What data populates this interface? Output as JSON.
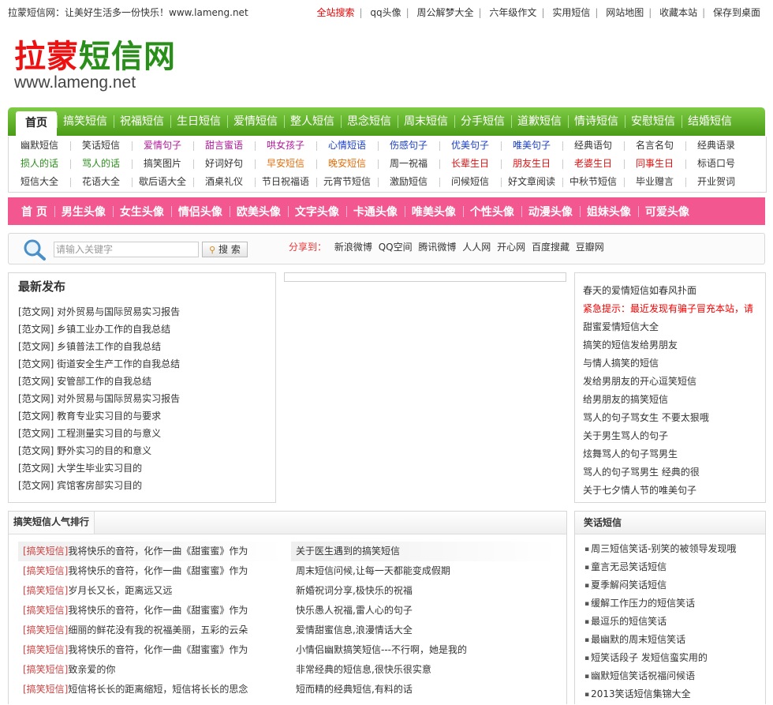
{
  "topbar": {
    "slogan": "拉蒙短信网：让美好生活多一份快乐！www.lameng.net",
    "links": [
      "全站搜索",
      "qq头像",
      "周公解梦大全",
      "六年级作文",
      "实用短信",
      "网站地图",
      "收藏本站",
      "保存到桌面"
    ]
  },
  "logo": {
    "cn_part1": "拉蒙",
    "cn_part2": "短信网",
    "en": "www.lameng.net"
  },
  "green_nav": [
    "首页",
    "搞笑短信",
    "祝福短信",
    "生日短信",
    "爱情短信",
    "整人短信",
    "思念短信",
    "周末短信",
    "分手短信",
    "道歉短信",
    "情诗短信",
    "安慰短信",
    "结婚短信"
  ],
  "link_grid": [
    [
      {
        "t": "幽默短信",
        "c": "#333"
      },
      {
        "t": "笑话短信",
        "c": "#333"
      },
      {
        "t": "爱情句子",
        "c": "#b0189a"
      },
      {
        "t": "甜言蜜语",
        "c": "#b0189a"
      },
      {
        "t": "哄女孩子",
        "c": "#b0189a"
      },
      {
        "t": "心情短语",
        "c": "#1a3fc8"
      },
      {
        "t": "伤感句子",
        "c": "#1a3fc8"
      },
      {
        "t": "优美句子",
        "c": "#1a3fc8"
      },
      {
        "t": "唯美句子",
        "c": "#1a3fc8"
      },
      {
        "t": "经典语句",
        "c": "#333"
      },
      {
        "t": "名言名句",
        "c": "#333"
      },
      {
        "t": "经典语录",
        "c": "#333"
      }
    ],
    [
      {
        "t": "损人的话",
        "c": "#2a8f1a"
      },
      {
        "t": "骂人的话",
        "c": "#2a8f1a"
      },
      {
        "t": "搞笑图片",
        "c": "#333"
      },
      {
        "t": "好词好句",
        "c": "#333"
      },
      {
        "t": "早安短信",
        "c": "#e07010"
      },
      {
        "t": "晚安短信",
        "c": "#e07010"
      },
      {
        "t": "周一祝福",
        "c": "#333"
      },
      {
        "t": "长辈生日",
        "c": "#e01010"
      },
      {
        "t": "朋友生日",
        "c": "#e01010"
      },
      {
        "t": "老婆生日",
        "c": "#e01010"
      },
      {
        "t": "同事生日",
        "c": "#e01010"
      },
      {
        "t": "标语口号",
        "c": "#333"
      }
    ],
    [
      {
        "t": "短信大全",
        "c": "#333"
      },
      {
        "t": "花语大全",
        "c": "#333"
      },
      {
        "t": "歇后语大全",
        "c": "#333"
      },
      {
        "t": "酒桌礼仪",
        "c": "#333"
      },
      {
        "t": "节日祝福语",
        "c": "#333"
      },
      {
        "t": "元宵节短信",
        "c": "#333"
      },
      {
        "t": "激励短信",
        "c": "#333"
      },
      {
        "t": "问候短信",
        "c": "#333"
      },
      {
        "t": "好文章阅读",
        "c": "#333"
      },
      {
        "t": "中秋节短信",
        "c": "#333"
      },
      {
        "t": "毕业赠言",
        "c": "#333"
      },
      {
        "t": "开业贺词",
        "c": "#333"
      }
    ]
  ],
  "pink_nav": [
    "首 页",
    "男生头像",
    "女生头像",
    "情侣头像",
    "欧美头像",
    "文字头像",
    "卡通头像",
    "唯美头像",
    "个性头像",
    "动漫头像",
    "姐妹头像",
    "可爱头像"
  ],
  "search": {
    "placeholder": "请输入关键字",
    "button": "搜 索",
    "share_label": "分享到：",
    "share_targets": [
      "新浪微博",
      "QQ空间",
      "腾讯微博",
      "人人网",
      "开心网",
      "百度搜藏",
      "豆瓣网"
    ]
  },
  "latest": {
    "title": "最新发布",
    "items": [
      "[范文网] 对外贸易与国际贸易实习报告",
      "[范文网] 乡镇工业办工作的自我总结",
      "[范文网] 乡镇普法工作的自我总结",
      "[范文网] 街道安全生产工作的自我总结",
      "[范文网] 安管部工作的自我总结",
      "[范文网] 对外贸易与国际贸易实习报告",
      "[范文网] 教育专业实习目的与要求",
      "[范文网] 工程测量实习目的与意义",
      "[范文网] 野外实习的目的和意义",
      "[范文网] 大学生毕业实习目的",
      "[范文网] 宾馆客房部实习目的"
    ]
  },
  "right_list": {
    "items": [
      "春天的爱情短信如春风扑面",
      "紧急提示：最近发现有骗子冒充本站，请",
      "甜蜜爱情短信大全",
      "搞笑的短信发给男朋友",
      "与情人搞笑的短信",
      "发给男朋友的开心逗笑短信",
      "给男朋友的搞笑短信",
      "骂人的句子骂女生 不要太狠哦",
      "关于男生骂人的句子",
      "炫舞骂人的句子骂男生",
      "骂人的句子骂男生 经典的很",
      "关于七夕情人节的唯美句子"
    ],
    "alert_index": 1,
    "alert_color": "#e00000"
  },
  "rank": {
    "title": "搞笑短信人气排行",
    "tag": "[搞笑短信]",
    "left": [
      "我将快乐的音符，化作一曲《甜蜜蜜》作为",
      "我将快乐的音符，化作一曲《甜蜜蜜》作为",
      "岁月长又长，距离远又远",
      "我将快乐的音符，化作一曲《甜蜜蜜》作为",
      "细丽的鲜花没有我的祝福美丽，五彩的云朵",
      "我将快乐的音符，化作一曲《甜蜜蜜》作为",
      "致亲爱的你",
      "短信将长长的距离缩短，短信将长长的思念"
    ],
    "right": [
      "关于医生遇到的搞笑短信",
      "周末短信问候,让每一天都能变成假期",
      "新婚祝词分享,极快乐的祝福",
      "快乐愚人祝福,雷人心的句子",
      "爱情甜蜜信息,浪漫情话大全",
      "小情侣幽默搞笑短信---不行啊，她是我的",
      "非常经典的短信息,很快乐很实意",
      "短而精的经典短信,有料的话"
    ]
  },
  "jokes": {
    "title": "笑话短信",
    "items": [
      "周三短信笑话-别笑的被领导发现哦",
      "童言无忌笑话短信",
      "夏季解闷笑话短信",
      "缓解工作压力的短信笑话",
      "最逗乐的短信笑话",
      "最幽默的周末短信笑话",
      "短笑话段子 发短信蛮实用的",
      "幽默短信笑话祝福问候语",
      "2013笑话短信集锦大全"
    ]
  },
  "colors": {
    "green_nav": "#5aab22",
    "pink_nav": "#f2578f",
    "logo_red": "#e11111",
    "logo_green": "#2a8f1a",
    "tag_red": "#cc4444"
  }
}
